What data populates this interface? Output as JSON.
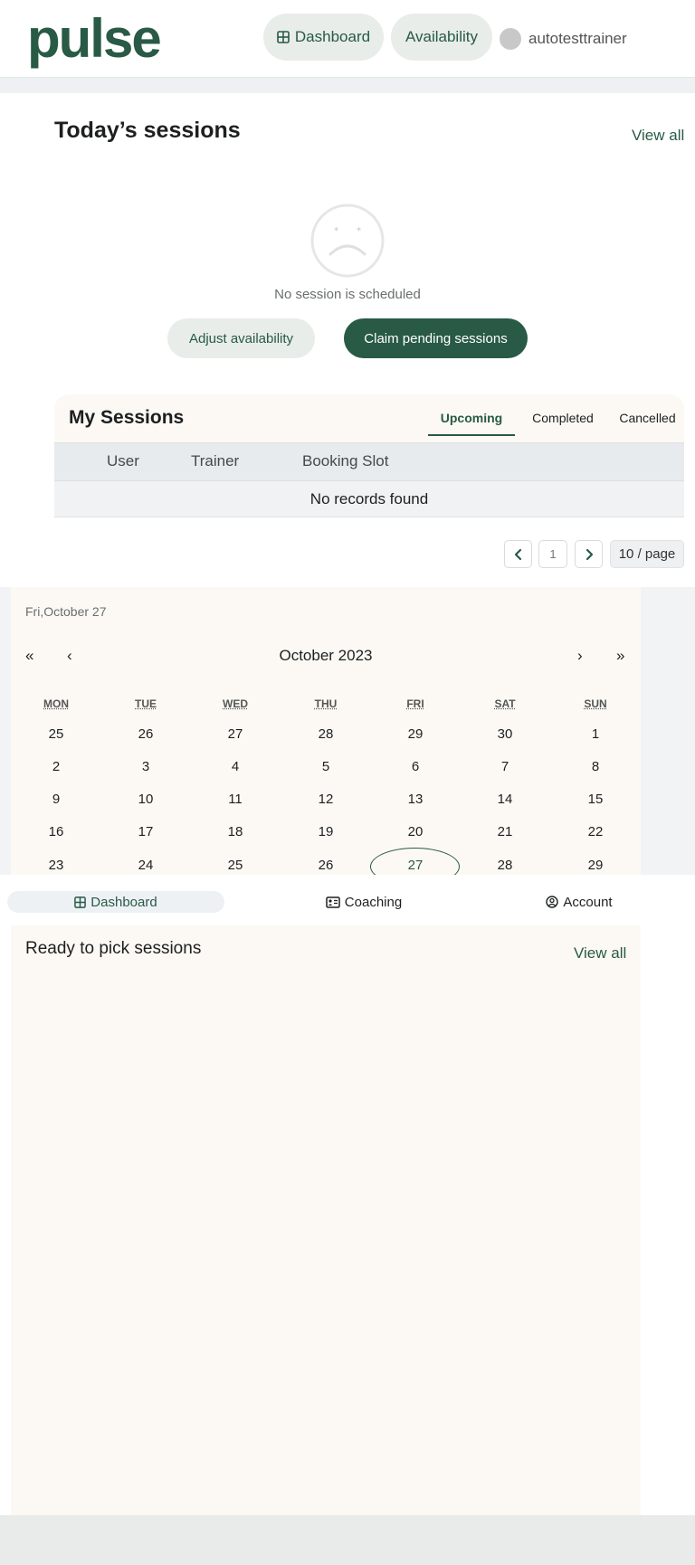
{
  "header": {
    "logo": "pulse",
    "nav": {
      "dashboard": "Dashboard",
      "availability": "Availability"
    },
    "username": "autotesttrainer"
  },
  "today": {
    "title": "Today’s sessions",
    "view_all": "View all",
    "empty_message": "No session is scheduled",
    "adjust_button": "Adjust availability",
    "claim_button": "Claim pending sessions"
  },
  "my_sessions": {
    "title": "My Sessions",
    "tabs": [
      "Upcoming",
      "Completed",
      "Cancelled"
    ],
    "active_tab": "Upcoming",
    "columns": [
      "User",
      "Trainer",
      "Booking Slot"
    ],
    "empty": "No records found",
    "pagination": {
      "page": "1",
      "page_size": "10 / page"
    }
  },
  "calendar": {
    "selected_label": "Fri,October 27",
    "month_label": "October 2023",
    "nav": {
      "prev_year": "«",
      "prev_month": "‹",
      "next_month": "›",
      "next_year": "»"
    },
    "weekdays": [
      "MON",
      "TUE",
      "WED",
      "THU",
      "FRI",
      "SAT",
      "SUN"
    ],
    "weeks": [
      [
        "25",
        "26",
        "27",
        "28",
        "29",
        "30",
        "1"
      ],
      [
        "2",
        "3",
        "4",
        "5",
        "6",
        "7",
        "8"
      ],
      [
        "9",
        "10",
        "11",
        "12",
        "13",
        "14",
        "15"
      ],
      [
        "16",
        "17",
        "18",
        "19",
        "20",
        "21",
        "22"
      ],
      [
        "23",
        "24",
        "25",
        "26",
        "27",
        "28",
        "29"
      ]
    ],
    "today": "27"
  },
  "bottom_nav": {
    "dashboard": "Dashboard",
    "coaching": "Coaching",
    "account": "Account"
  },
  "pick": {
    "title": "Ready to pick sessions",
    "view_all": "View all"
  },
  "colors": {
    "brand": "#285a45",
    "card": "#fcf9f4",
    "pill": "#e8ede9"
  }
}
